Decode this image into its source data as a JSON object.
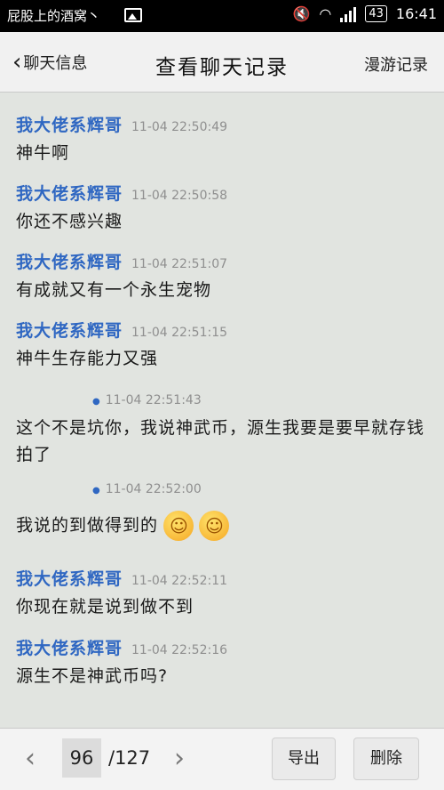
{
  "status_bar": {
    "notification": "屁股上的酒窝丶",
    "battery": "43",
    "time": "16:41"
  },
  "title_bar": {
    "back_label": "聊天信息",
    "title": "查看聊天记录",
    "roam_label": "漫游记录"
  },
  "messages": [
    {
      "sender": "我大佬系辉哥",
      "time": "11-04 22:50:49",
      "text": "神牛啊"
    },
    {
      "sender": "我大佬系辉哥",
      "time": "11-04 22:50:58",
      "text": "你还不感兴趣"
    },
    {
      "sender": "我大佬系辉哥",
      "time": "11-04 22:51:07",
      "text": "有成就又有一个永生宠物"
    },
    {
      "sender": "我大佬系辉哥",
      "time": "11-04 22:51:15",
      "text": "神牛生存能力又强"
    },
    {
      "sender": "",
      "time": "11-04 22:51:43",
      "text": "这个不是坑你，我说神武币，源生我要是要早就存钱拍了"
    },
    {
      "sender": "",
      "time": "11-04 22:52:00",
      "text": "我说的到做得到的"
    },
    {
      "sender": "我大佬系辉哥",
      "time": "11-04 22:52:11",
      "text": "你现在就是说到做不到"
    },
    {
      "sender": "我大佬系辉哥",
      "time": "11-04 22:52:16",
      "text": "源生不是神武币吗?"
    }
  ],
  "bottom_bar": {
    "current_page": "96",
    "total_pages": "/127",
    "export_label": "导出",
    "delete_label": "删除"
  }
}
